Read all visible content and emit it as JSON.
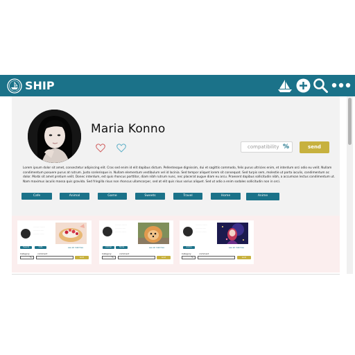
{
  "header": {
    "brand": "SHIP",
    "logo_icon": "ship-seal-icon",
    "nav_icons": [
      "sailboat-icon",
      "plus-circle-icon",
      "search-icon",
      "more-dots-icon"
    ]
  },
  "profile": {
    "name": "Maria Konno",
    "compatibility_placeholder": "compatibility",
    "compatibility_unit": "%",
    "send_label": "send",
    "bio": "Lorem ipsum dolor sit amet, consectetur adipiscing elit. Cras sed enim id elit dapibus dictum. Pellentesque dignissim, dui et sagittis commodo, felis purus ultricies enim, et interdum orci odio eu velit. Nullam condimentum posuere purus at rutrum. Justo scelerisque in. Nullam elementum vestibulum vel id lacinia. Sed tempor aliquet lorem sit consequat. Sed turpis sem, molestie ut porta iaculis, condimentum ac dolor. Morbi sit amet pretium velit. Donec interdum, est quis rhoncus porttitor, diam nibh rutrum nunc, nec placerat augue diam eu arcu. Praesent dapibus sollicitudin nibh, a accumsan lectus condimentum ut. Nam maximus iaculis massa quis gravida. Sed fringilla risus non rhoncus ullamcorper, sed at elit quis risus varius aliquet. Sed ut odio a enim sodales sollicitudin non in orci.",
    "tags": [
      "Cafe",
      "Animal",
      "Game",
      "Sweets",
      "Travel",
      "Home",
      "Anime"
    ]
  },
  "posts": [
    {
      "tags": [
        "Sweets",
        "Cafe"
      ],
      "link": "see all matches",
      "field_label_1": "Category",
      "field_label_2": "comment",
      "unit": "%",
      "send_label": "send",
      "image_icon": "dessert-photo"
    },
    {
      "tags": [
        "Animal",
        "Home"
      ],
      "link": "see all matches",
      "field_label_1": "Category",
      "field_label_2": "comment",
      "unit": "%",
      "send_label": "send",
      "image_icon": "puppy-photo"
    },
    {
      "tags": [
        "Anime"
      ],
      "link": "see all matches",
      "field_label_1": "Category",
      "field_label_2": "comment",
      "unit": "%",
      "send_label": "send",
      "image_icon": "anime-art-photo"
    }
  ],
  "colors": {
    "primary": "#1b7289",
    "accent": "#c7b13e",
    "panel": "#f2f2f2",
    "posts_bg": "#fbeeee"
  }
}
